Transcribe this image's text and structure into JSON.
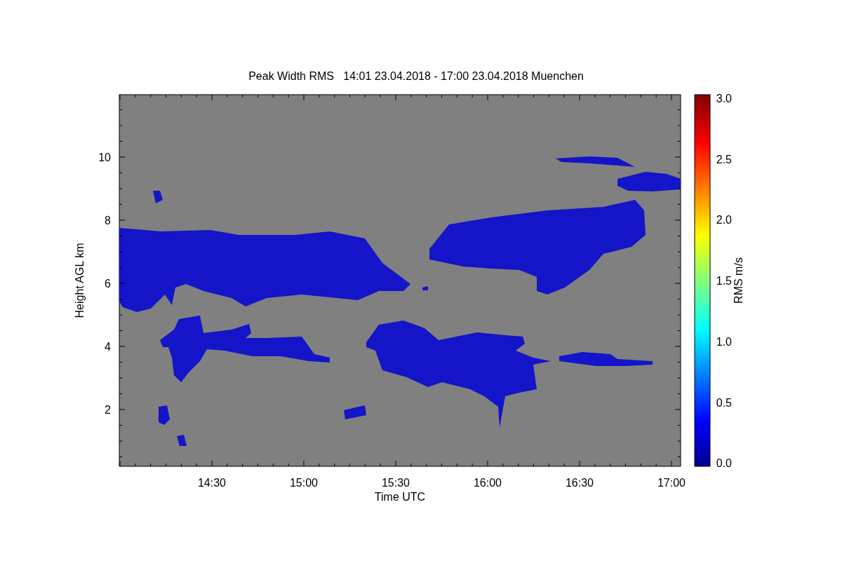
{
  "title": "Peak Width RMS   14:01 23.04.2018 - 17:00 23.04.2018 Muenchen",
  "x_axis": {
    "label": "Time UTC",
    "ticks": [
      "14:30",
      "15:00",
      "15:30",
      "16:00",
      "16:30",
      "17:00"
    ]
  },
  "y_axis": {
    "label": "Height AGL km",
    "ticks": [
      "10",
      "8",
      "6",
      "4",
      "2"
    ]
  },
  "colorbar": {
    "label": "RMS m/s",
    "ticks": [
      "3.0",
      "2.5",
      "2.0",
      "1.5",
      "1.0",
      "0.5",
      "0.0"
    ]
  }
}
